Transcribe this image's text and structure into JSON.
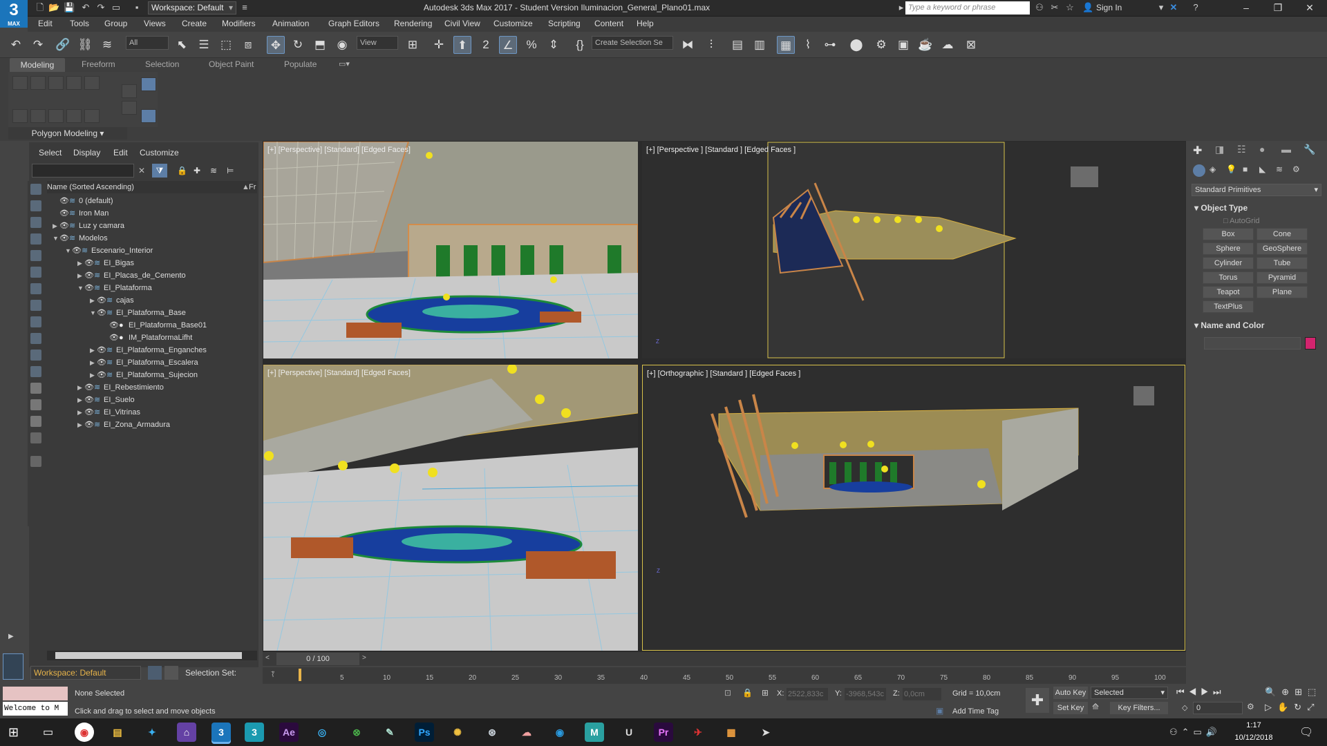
{
  "app": {
    "logo_text": "3",
    "logo_sub": "MAX",
    "workspace": "Workspace: Default",
    "title": "Autodesk 3ds Max 2017 - Student Version    Iluminacion_General_Plano01.max",
    "search_placeholder": "Type a keyword or phrase",
    "sign_in": "Sign In"
  },
  "menu": [
    "Edit",
    "Tools",
    "Group",
    "Views",
    "Create",
    "Modifiers",
    "Animation",
    "Graph Editors",
    "Rendering",
    "Civil View",
    "Customize",
    "Scripting",
    "Content",
    "Help"
  ],
  "toolbar": {
    "filter_all": "All",
    "ref_coord": "View",
    "selection_set": "Create Selection Se"
  },
  "ribbon": {
    "tabs": [
      "Modeling",
      "Freeform",
      "Selection",
      "Object Paint",
      "Populate"
    ],
    "panel_label": "Polygon Modeling"
  },
  "scene_explorer": {
    "menus": [
      "Select",
      "Display",
      "Edit",
      "Customize"
    ],
    "column_header": "Name (Sorted Ascending)",
    "column_header2": "Fr",
    "rows": [
      {
        "label": "0 (default)",
        "level": 0,
        "twisty": "",
        "icon": "layer"
      },
      {
        "label": "Iron Man",
        "level": 0,
        "twisty": "",
        "icon": "layer"
      },
      {
        "label": "Luz y camara",
        "level": 0,
        "twisty": "▶",
        "icon": "layer"
      },
      {
        "label": "Modelos",
        "level": 0,
        "twisty": "▼",
        "icon": "layer"
      },
      {
        "label": "Escenario_Interior",
        "level": 1,
        "twisty": "▼",
        "icon": "layer"
      },
      {
        "label": "EI_Bigas",
        "level": 2,
        "twisty": "▶",
        "icon": "layer"
      },
      {
        "label": "EI_Placas_de_Cemento",
        "level": 2,
        "twisty": "▶",
        "icon": "layer"
      },
      {
        "label": "EI_Plataforma",
        "level": 2,
        "twisty": "▼",
        "icon": "layer"
      },
      {
        "label": "cajas",
        "level": 3,
        "twisty": "▶",
        "icon": "layer"
      },
      {
        "label": "EI_Plataforma_Base",
        "level": 3,
        "twisty": "▼",
        "icon": "layer"
      },
      {
        "label": "EI_Plataforma_Base01",
        "level": 4,
        "twisty": "",
        "icon": "object"
      },
      {
        "label": "IM_PlataformaLifht",
        "level": 4,
        "twisty": "",
        "icon": "object"
      },
      {
        "label": "EI_Plataforma_Enganches",
        "level": 3,
        "twisty": "▶",
        "icon": "layer"
      },
      {
        "label": "EI_Plataforma_Escalera",
        "level": 3,
        "twisty": "▶",
        "icon": "layer"
      },
      {
        "label": "EI_Plataforma_Sujecion",
        "level": 3,
        "twisty": "▶",
        "icon": "layer"
      },
      {
        "label": "EI_Rebestimiento",
        "level": 2,
        "twisty": "▶",
        "icon": "layer"
      },
      {
        "label": "EI_Suelo",
        "level": 2,
        "twisty": "▶",
        "icon": "layer"
      },
      {
        "label": "EI_Vitrinas",
        "level": 2,
        "twisty": "▶",
        "icon": "layer"
      },
      {
        "label": "EI_Zona_Armadura",
        "level": 2,
        "twisty": "▶",
        "icon": "layer"
      }
    ],
    "workspace": "Workspace: Default",
    "selection_set": "Selection Set:"
  },
  "viewports": {
    "top_left": "[+] [Perspective] [Standard] [Edged Faces]",
    "top_right": "[+] [Perspective ] [Standard ] [Edged Faces ]",
    "bottom_left": "[+] [Perspective] [Standard] [Edged Faces]",
    "bottom_right": "[+] [Orthographic ] [Standard ] [Edged Faces ]"
  },
  "command_panel": {
    "category": "Standard Primitives",
    "object_type_title": "Object Type",
    "autogrid": "AutoGrid",
    "buttons": [
      "Box",
      "Cone",
      "Sphere",
      "GeoSphere",
      "Cylinder",
      "Tube",
      "Torus",
      "Pyramid",
      "Teapot",
      "Plane",
      "TextPlus"
    ],
    "name_color_title": "Name and Color",
    "swatch_color": "#d2246e"
  },
  "timeline": {
    "frame": "0 / 100",
    "ticks": [
      "0",
      "5",
      "10",
      "15",
      "20",
      "25",
      "30",
      "35",
      "40",
      "45",
      "50",
      "55",
      "60",
      "65",
      "70",
      "75",
      "80",
      "85",
      "90",
      "95",
      "100"
    ]
  },
  "status": {
    "maxscript": "Welcome to M",
    "selection": "None Selected",
    "prompt": "Click and drag to select and move objects",
    "x_label": "X:",
    "x_value": "2522,833c",
    "y_label": "Y:",
    "y_value": "-3968,543c",
    "z_label": "Z:",
    "z_value": "0,0cm",
    "grid": "Grid = 10,0cm",
    "add_time_tag": "Add Time Tag",
    "auto_key": "Auto Key",
    "set_key": "Set Key",
    "key_mode": "Selected",
    "key_filters": "Key Filters...",
    "frame_field": "0"
  },
  "taskbar": {
    "time": "1:17",
    "date": "10/12/2018"
  }
}
